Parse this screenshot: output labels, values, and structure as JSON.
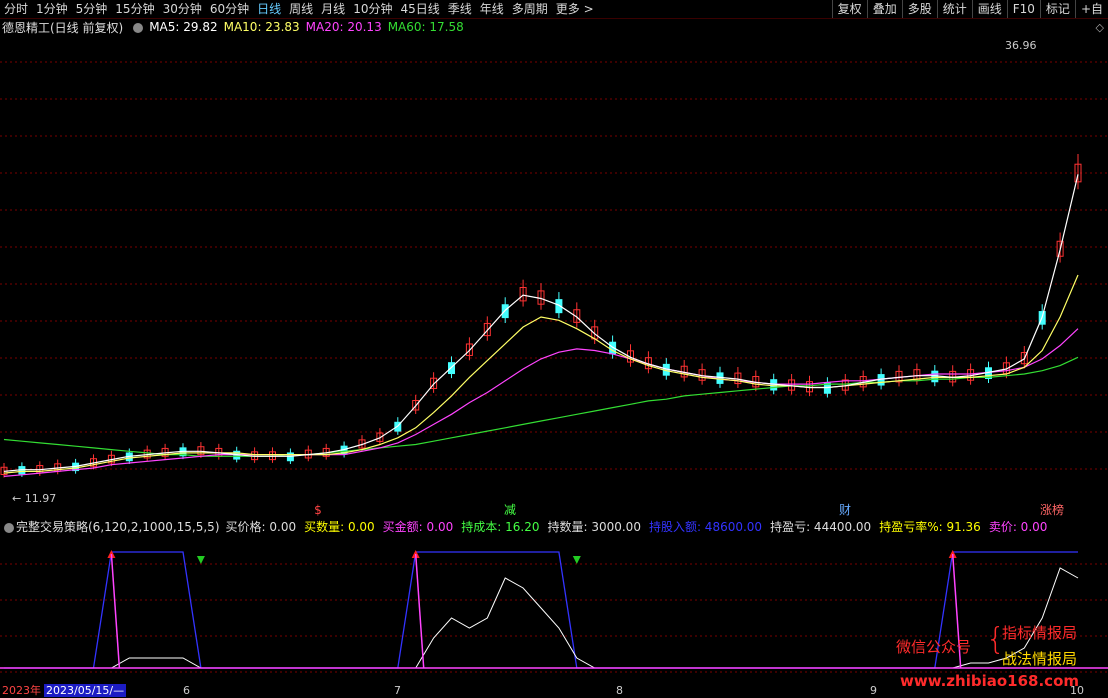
{
  "toolbar": {
    "periods": [
      "分时",
      "1分钟",
      "5分钟",
      "15分钟",
      "30分钟",
      "60分钟",
      "日线",
      "周线",
      "月线",
      "10分钟",
      "45日线",
      "季线",
      "年线",
      "多周期",
      "更多"
    ],
    "active_index": 6,
    "right": [
      "复权",
      "叠加",
      "多股",
      "统计",
      "画线",
      "F10",
      "标记",
      "+自"
    ]
  },
  "header": {
    "stock": "德恩精工(日线 前复权)",
    "ma5": "MA5: 29.82",
    "ma10": "MA10: 23.83",
    "ma20": "MA20: 20.13",
    "ma60": "MA60: 17.58"
  },
  "colors": {
    "ma5": "#ffffff",
    "ma10": "#ffff66",
    "ma20": "#ff44ff",
    "ma60": "#33dd33",
    "up": "#ff3333",
    "down": "#44ffff",
    "grid": "#7a0000"
  },
  "price_labels": {
    "high": "36.96",
    "low": "11.97"
  },
  "event_markers": [
    {
      "text": "$",
      "color": "#ff4444"
    },
    {
      "text": "减",
      "color": "#44ff44"
    },
    {
      "text": "财",
      "color": "#66aaff"
    },
    {
      "text": "涨榜",
      "color": "#ff6666"
    }
  ],
  "indicator": {
    "name": "完整交易策略(6,120,2,1000,15,5,5)",
    "fields": [
      {
        "label": "买价格: 0.00",
        "color": "#dddddd"
      },
      {
        "label": "买数量: 0.00",
        "color": "#ffff00"
      },
      {
        "label": "买金额: 0.00",
        "color": "#ff44ff"
      },
      {
        "label": "持成本: 16.20",
        "color": "#44ff44"
      },
      {
        "label": "持数量: 3000.00",
        "color": "#dddddd"
      },
      {
        "label": "持股入额: 48600.00",
        "color": "#3333ff"
      },
      {
        "label": "持盈亏: 44400.00",
        "color": "#dddddd"
      },
      {
        "label": "持盈亏率%: 91.36",
        "color": "#ffff00"
      },
      {
        "label": "卖价: 0.00",
        "color": "#ff44ff"
      }
    ]
  },
  "date_axis": {
    "year": "2023年",
    "current": "2023/05/15/—",
    "months": [
      "6",
      "7",
      "8",
      "9",
      "10"
    ]
  },
  "watermark": {
    "left": "微信公众号",
    "line1": "指标情报局",
    "line2": "战法情报局",
    "site": "www.zhibiao168.com"
  },
  "chart_data": {
    "type": "candlestick",
    "ma5": [
      12.3,
      12.4,
      12.4,
      12.5,
      12.6,
      12.8,
      13.0,
      13.2,
      13.3,
      13.4,
      13.5,
      13.5,
      13.4,
      13.3,
      13.2,
      13.2,
      13.2,
      13.3,
      13.4,
      13.6,
      13.9,
      14.3,
      15.0,
      16.2,
      17.5,
      18.5,
      19.5,
      20.7,
      21.9,
      22.8,
      22.6,
      22.2,
      21.5,
      20.5,
      19.7,
      19.1,
      18.7,
      18.4,
      18.2,
      18.0,
      17.9,
      17.8,
      17.6,
      17.5,
      17.4,
      17.3,
      17.3,
      17.4,
      17.6,
      17.8,
      17.9,
      18.0,
      18.0,
      17.9,
      18.0,
      18.2,
      18.4,
      19.0,
      21.5,
      25.5,
      30.0
    ],
    "ma10": [
      12.2,
      12.3,
      12.3,
      12.4,
      12.5,
      12.7,
      12.9,
      13.1,
      13.2,
      13.3,
      13.4,
      13.4,
      13.4,
      13.4,
      13.3,
      13.3,
      13.3,
      13.3,
      13.3,
      13.4,
      13.6,
      13.9,
      14.3,
      14.9,
      15.8,
      16.8,
      17.9,
      18.9,
      19.9,
      20.9,
      21.5,
      21.3,
      20.8,
      20.2,
      19.5,
      19.0,
      18.6,
      18.3,
      18.1,
      17.9,
      17.8,
      17.7,
      17.5,
      17.4,
      17.4,
      17.3,
      17.3,
      17.4,
      17.5,
      17.6,
      17.7,
      17.8,
      17.9,
      17.9,
      17.9,
      18.0,
      18.1,
      18.5,
      19.5,
      21.5,
      24.0
    ],
    "ma20": [
      12.0,
      12.1,
      12.2,
      12.3,
      12.4,
      12.5,
      12.7,
      12.8,
      12.9,
      13.0,
      13.1,
      13.2,
      13.3,
      13.3,
      13.3,
      13.3,
      13.3,
      13.3,
      13.3,
      13.3,
      13.5,
      13.7,
      14.0,
      14.5,
      15.1,
      15.7,
      16.4,
      17.0,
      17.7,
      18.4,
      19.0,
      19.4,
      19.6,
      19.5,
      19.3,
      19.0,
      18.7,
      18.4,
      18.2,
      18.0,
      17.8,
      17.7,
      17.6,
      17.5,
      17.5,
      17.5,
      17.6,
      17.7,
      17.7,
      17.8,
      17.9,
      18.0,
      18.1,
      18.1,
      18.1,
      18.2,
      18.3,
      18.5,
      19.0,
      19.8,
      20.8
    ],
    "ma60": [
      14.2,
      14.1,
      14.0,
      13.9,
      13.8,
      13.7,
      13.6,
      13.5,
      13.4,
      13.3,
      13.3,
      13.2,
      13.2,
      13.2,
      13.2,
      13.2,
      13.3,
      13.3,
      13.4,
      13.5,
      13.6,
      13.7,
      13.8,
      13.9,
      14.1,
      14.3,
      14.5,
      14.7,
      14.9,
      15.1,
      15.3,
      15.5,
      15.7,
      15.9,
      16.1,
      16.3,
      16.5,
      16.6,
      16.8,
      16.9,
      17.0,
      17.1,
      17.2,
      17.3,
      17.4,
      17.4,
      17.5,
      17.5,
      17.6,
      17.6,
      17.7,
      17.7,
      17.8,
      17.8,
      17.9,
      17.9,
      18.0,
      18.1,
      18.3,
      18.6,
      19.1
    ],
    "indicator_series": {
      "position_line": [
        0,
        0,
        0,
        0,
        0,
        0,
        1,
        1,
        1,
        1,
        1,
        0,
        0,
        0,
        0,
        0,
        0,
        0,
        0,
        0,
        0,
        0,
        0,
        1,
        1,
        1,
        1,
        1,
        1,
        1,
        1,
        1,
        0,
        0,
        0,
        0,
        0,
        0,
        0,
        0,
        0,
        0,
        0,
        0,
        0,
        0,
        0,
        0,
        0,
        0,
        0,
        0,
        0,
        1,
        1,
        1,
        1,
        1,
        1,
        1,
        1
      ],
      "profit": [
        0,
        0,
        0,
        0,
        0,
        0,
        0,
        0.1,
        0.1,
        0.1,
        0.1,
        0,
        0,
        0,
        0,
        0,
        0,
        0,
        0,
        0,
        0,
        0,
        0,
        0,
        0.3,
        0.5,
        0.4,
        0.5,
        0.9,
        0.8,
        0.6,
        0.4,
        0.1,
        0,
        0,
        0,
        0,
        0,
        0,
        0,
        0,
        0,
        0,
        0,
        0,
        0,
        0,
        0,
        0,
        0,
        0,
        0,
        0,
        0,
        0.05,
        0.05,
        0.1,
        0.2,
        0.5,
        1.0,
        0.9
      ]
    }
  }
}
